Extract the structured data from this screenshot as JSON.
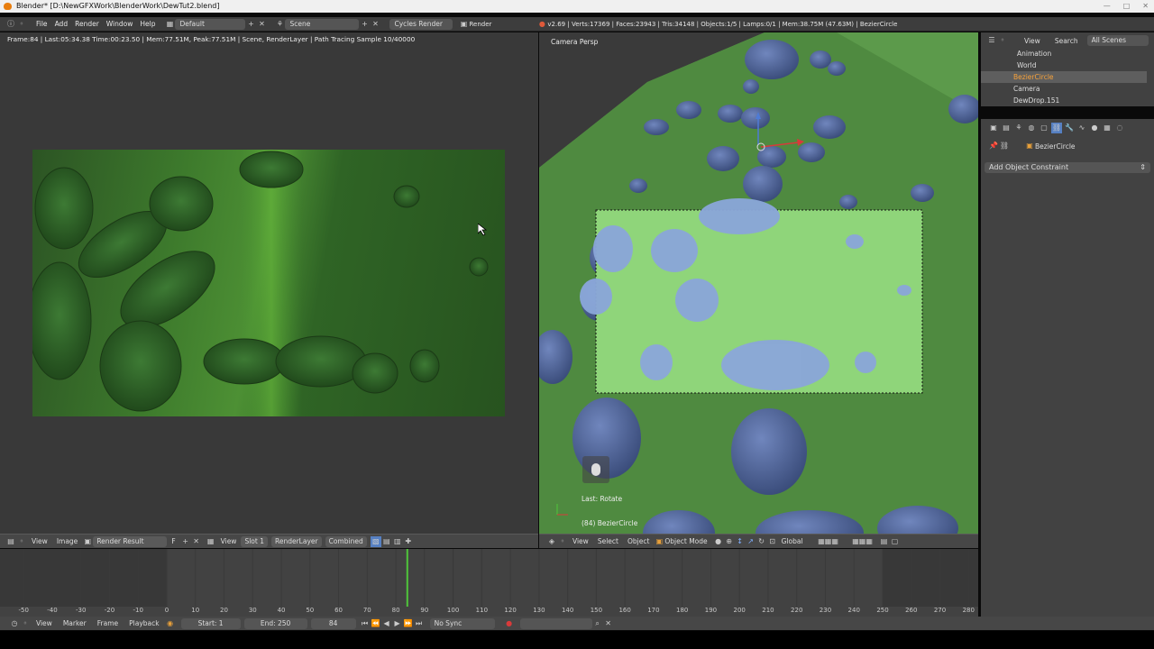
{
  "window": {
    "title": "Blender* [D:\\NewGFXWork\\BlenderWork\\DewTut2.blend]"
  },
  "infobar": {
    "menus": [
      "File",
      "Add",
      "Render",
      "Window",
      "Help"
    ],
    "layout": "Default",
    "scene": "Scene",
    "engine": "Cycles Render",
    "render_label": "Render",
    "stats": "v2.69 | Verts:17369 | Faces:23943 | Tris:34148 | Objects:1/5 | Lamps:0/1 | Mem:38.75M (47.63M) | BezierCircle"
  },
  "uv_editor": {
    "stats": "Frame:84 | Last:05:34.38 Time:00:23.50 | Mem:77.51M, Peak:77.51M | Scene, RenderLayer | Path Tracing Sample 10/40000",
    "header": {
      "view": "View",
      "image": "Image",
      "image_name": "Render Result",
      "f_label": "F",
      "view2": "View",
      "slot": "Slot 1",
      "layer": "RenderLayer",
      "pass": "Combined"
    }
  },
  "viewport": {
    "label": "Camera Persp",
    "last_op": "Last: Rotate",
    "object_label": "(84) BezierCircle",
    "header": {
      "view": "View",
      "select": "Select",
      "object": "Object",
      "mode": "Object Mode",
      "orientation": "Global"
    }
  },
  "outliner": {
    "header": {
      "view": "View",
      "search": "Search",
      "scenes": "All Scenes"
    },
    "items": [
      "Animation",
      "World",
      "BezierCircle",
      "Camera",
      "DewDrop.151"
    ]
  },
  "properties": {
    "object": "BezierCircle",
    "add_constraint": "Add Object Constraint"
  },
  "timeline": {
    "ticks": [
      "-50",
      "-40",
      "-30",
      "-20",
      "-10",
      "0",
      "10",
      "20",
      "30",
      "40",
      "50",
      "60",
      "70",
      "80",
      "90",
      "100",
      "110",
      "120",
      "130",
      "140",
      "150",
      "160",
      "170",
      "180",
      "190",
      "200",
      "210",
      "220",
      "230",
      "240",
      "250",
      "260",
      "270",
      "280"
    ],
    "current_frame": 84,
    "header": {
      "view": "View",
      "marker": "Marker",
      "frame": "Frame",
      "playback": "Playback",
      "start": "Start: 1",
      "end": "End: 250",
      "current": "84",
      "sync": "No Sync"
    }
  },
  "colors": {
    "accent": "#e87d0d",
    "playhead": "#4fc63a",
    "cam_plane": "#8fd57a",
    "drops": "#8aa7d8"
  }
}
